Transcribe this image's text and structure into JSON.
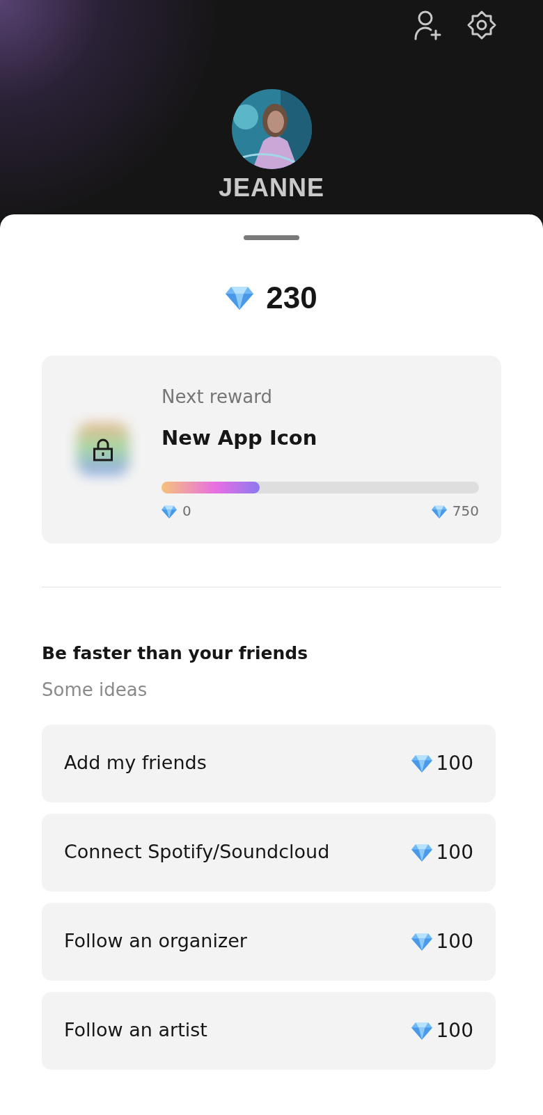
{
  "header": {
    "name": "JEANNE"
  },
  "balance": "230",
  "next_reward": {
    "label": "Next reward",
    "title": "New App Icon",
    "locked": true,
    "level": 0.31,
    "min": "0",
    "max": "750"
  },
  "ideas": {
    "title": "Be faster than your friends",
    "subtitle": "Some ideas",
    "items": [
      {
        "label": "Add my friends",
        "reward": "100"
      },
      {
        "label": "Connect Spotify/Soundcloud",
        "reward": "100"
      },
      {
        "label": "Follow an organizer",
        "reward": "100"
      },
      {
        "label": "Follow an artist",
        "reward": "100"
      }
    ]
  }
}
